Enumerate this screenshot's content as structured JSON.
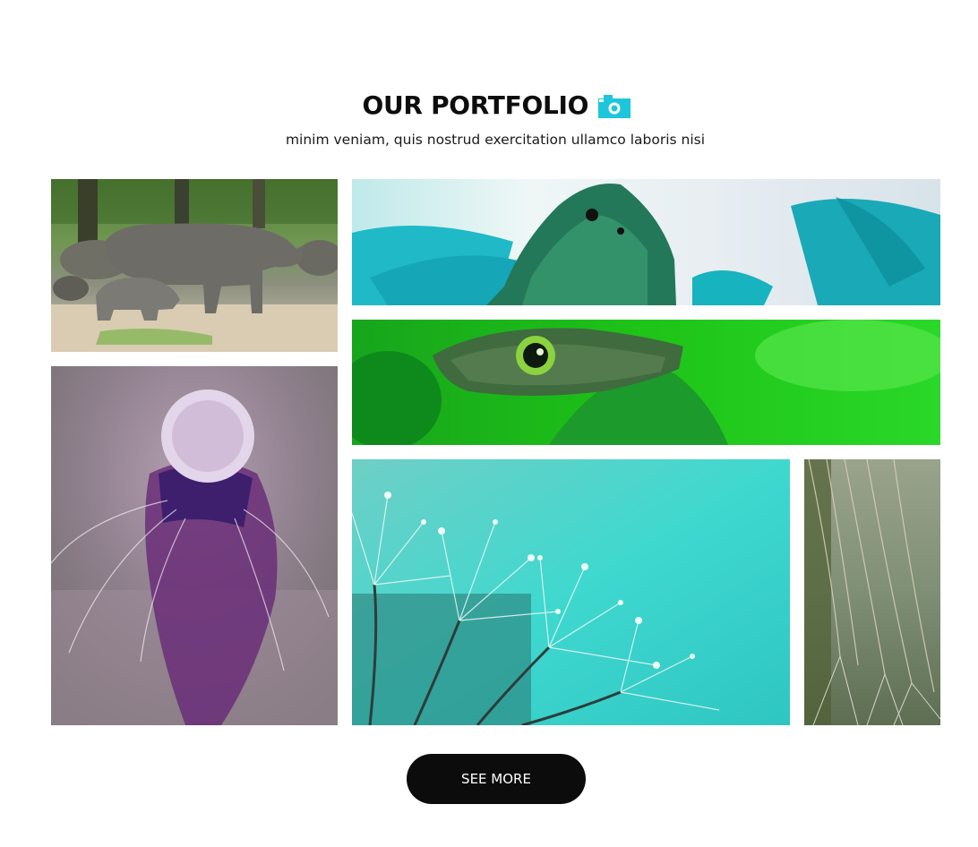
{
  "portfolio": {
    "title": "OUR PORTFOLIO",
    "title_icon": "camera-icon",
    "subtitle": "minim veniam, quis nostrud exercitation ullamco laboris nisi",
    "accent_color": "#1ec6dc",
    "gallery": [
      {
        "name": "rhinos",
        "subject": "rhinoceros with calf"
      },
      {
        "name": "butterfly-teal",
        "subject": "butterfly wing on teal leaves"
      },
      {
        "name": "butterfly-green",
        "subject": "owl butterfly on green leaf"
      },
      {
        "name": "dandelion-purple",
        "subject": "purple dandelion seed head"
      },
      {
        "name": "dandelion-dew",
        "subject": "dandelion seeds with dew on turquoise"
      },
      {
        "name": "dandelion-side",
        "subject": "dandelion seeds close-up"
      }
    ],
    "button_label": "SEE MORE"
  }
}
